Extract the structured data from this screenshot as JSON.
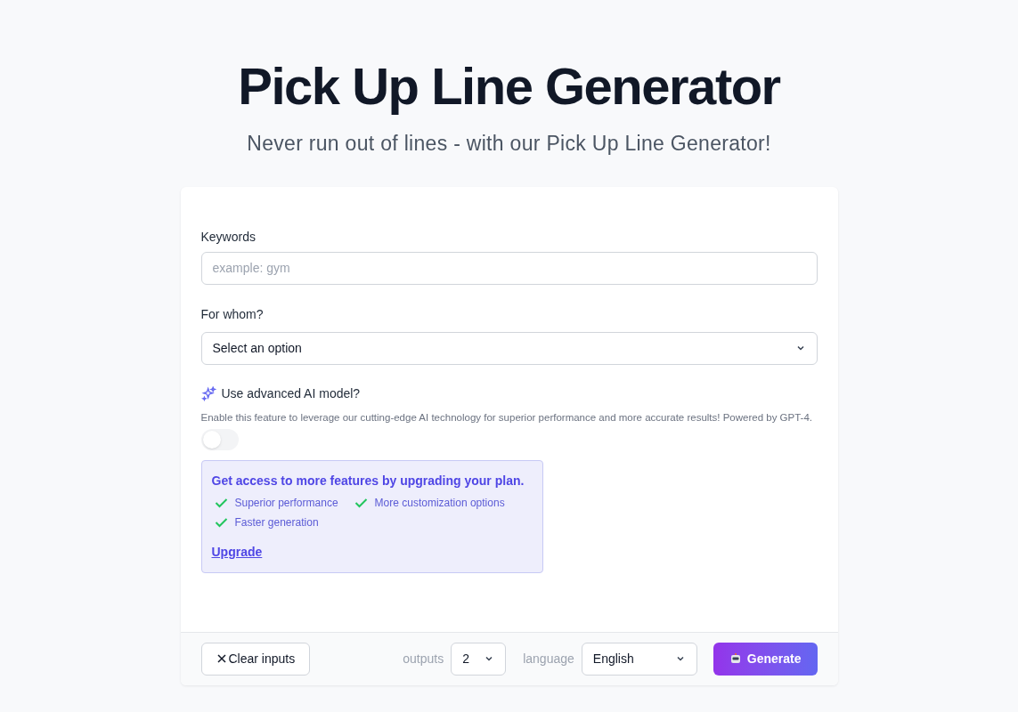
{
  "header": {
    "title": "Pick Up Line Generator",
    "subtitle": "Never run out of lines - with our Pick Up Line Generator!"
  },
  "form": {
    "keywords": {
      "label": "Keywords",
      "placeholder": "example: gym"
    },
    "for_whom": {
      "label": "For whom?",
      "value": "Select an option"
    },
    "advanced": {
      "label": "Use advanced AI model?",
      "description": "Enable this feature to leverage our cutting-edge AI technology for superior performance and more accurate results! Powered by GPT-4.",
      "on": false
    },
    "upgrade": {
      "title": "Get access to more features by upgrading your plan.",
      "features": [
        "Superior performance",
        "More customization options",
        "Faster generation"
      ],
      "link": "Upgrade"
    }
  },
  "footer": {
    "clear": "Clear inputs",
    "outputs_label": "outputs",
    "outputs_value": "2",
    "language_label": "language",
    "language_value": "English",
    "generate": "Generate"
  }
}
